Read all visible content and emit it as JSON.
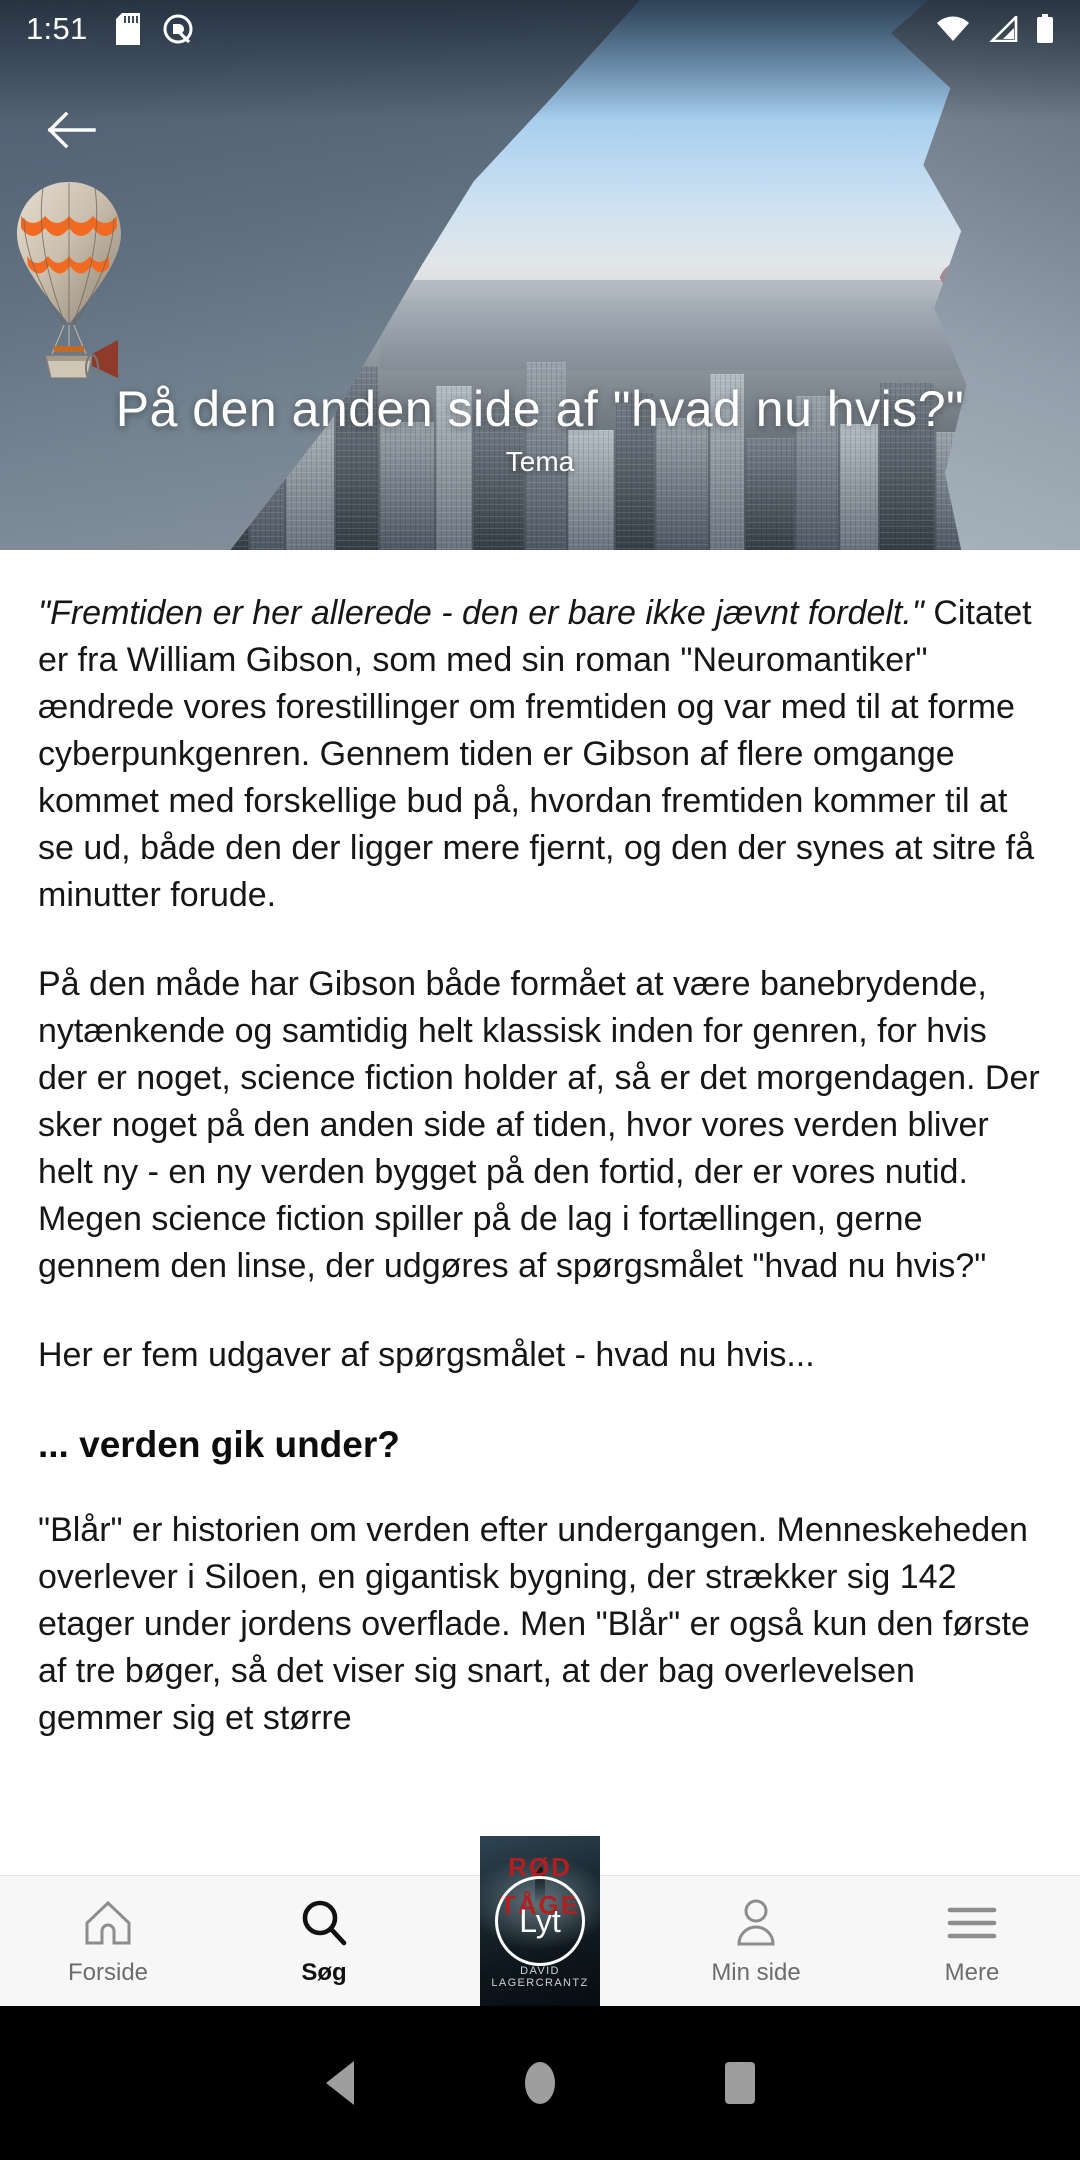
{
  "statusbar": {
    "time": "1:51",
    "icons": [
      "sd-card-icon",
      "do-not-disturb-icon",
      "wifi-icon",
      "cell-signal-icon",
      "battery-icon"
    ]
  },
  "hero": {
    "back_label": "back-arrow",
    "title": "På den anden side af \"hvad nu hvis?\"",
    "subtitle": "Tema"
  },
  "article": {
    "paragraphs": [
      {
        "italic_lead": "\"Fremtiden er her allerede - den er bare ikke jævnt fordelt.\"",
        "rest": " Citatet er fra William Gibson, som med sin roman \"Neuromantiker\" ændrede vores forestillinger om fremtiden og var med til at forme cyberpunkgenren. Gennem tiden er Gibson af flere omgange kommet med forskellige bud på, hvordan fremtiden kommer til at se ud, både den der ligger mere fjernt, og den der synes at sitre få minutter forude."
      },
      {
        "italic_lead": "",
        "rest": "På den måde har Gibson både formået at være banebrydende, nytænkende og samtidig helt klassisk inden for genren, for hvis der er noget, science fiction holder af, så er det morgendagen. Der sker noget på den anden side af tiden, hvor vores verden bliver helt ny - en ny verden bygget på den fortid, der er vores nutid. Megen science fiction spiller på de lag i fortællingen, gerne gennem den linse, der udgøres af spørgsmålet \"hvad nu hvis?\""
      },
      {
        "italic_lead": "",
        "rest": "Her er fem udgaver af spørgsmålet - hvad nu hvis..."
      }
    ],
    "heading": "... verden gik under?",
    "after_heading": "\"Blår\" er historien om verden efter undergangen. Menneskeheden overlever i Siloen, en gigantisk bygning, der strækker sig 142 etager under jordens overflade. Men \"Blår\" er også kun den første af tre bøger, så det viser sig snart, at der bag overlevelsen gemmer sig et større"
  },
  "bottomnav": {
    "items": [
      {
        "id": "forside",
        "label": "Forside",
        "icon": "home-icon",
        "active": false
      },
      {
        "id": "sog",
        "label": "Søg",
        "icon": "search-icon",
        "active": true
      },
      {
        "id": "min-side",
        "label": "Min side",
        "icon": "person-icon",
        "active": false
      },
      {
        "id": "mere",
        "label": "Mere",
        "icon": "hamburger-icon",
        "active": false
      }
    ],
    "player": {
      "listen_label": "Lyt",
      "cover_title_line1": "RØD",
      "cover_title_line2": "TÅGE",
      "cover_author": "DAVID LAGERCRANTZ"
    }
  },
  "androidnav": {
    "back": "android-back",
    "home": "android-home",
    "recents": "android-recents"
  },
  "colors": {
    "accent_red": "#b02020",
    "nav_bg": "#f7f7f7",
    "nav_inactive": "#6d6d6d",
    "nav_active": "#111111",
    "text": "#161616"
  }
}
